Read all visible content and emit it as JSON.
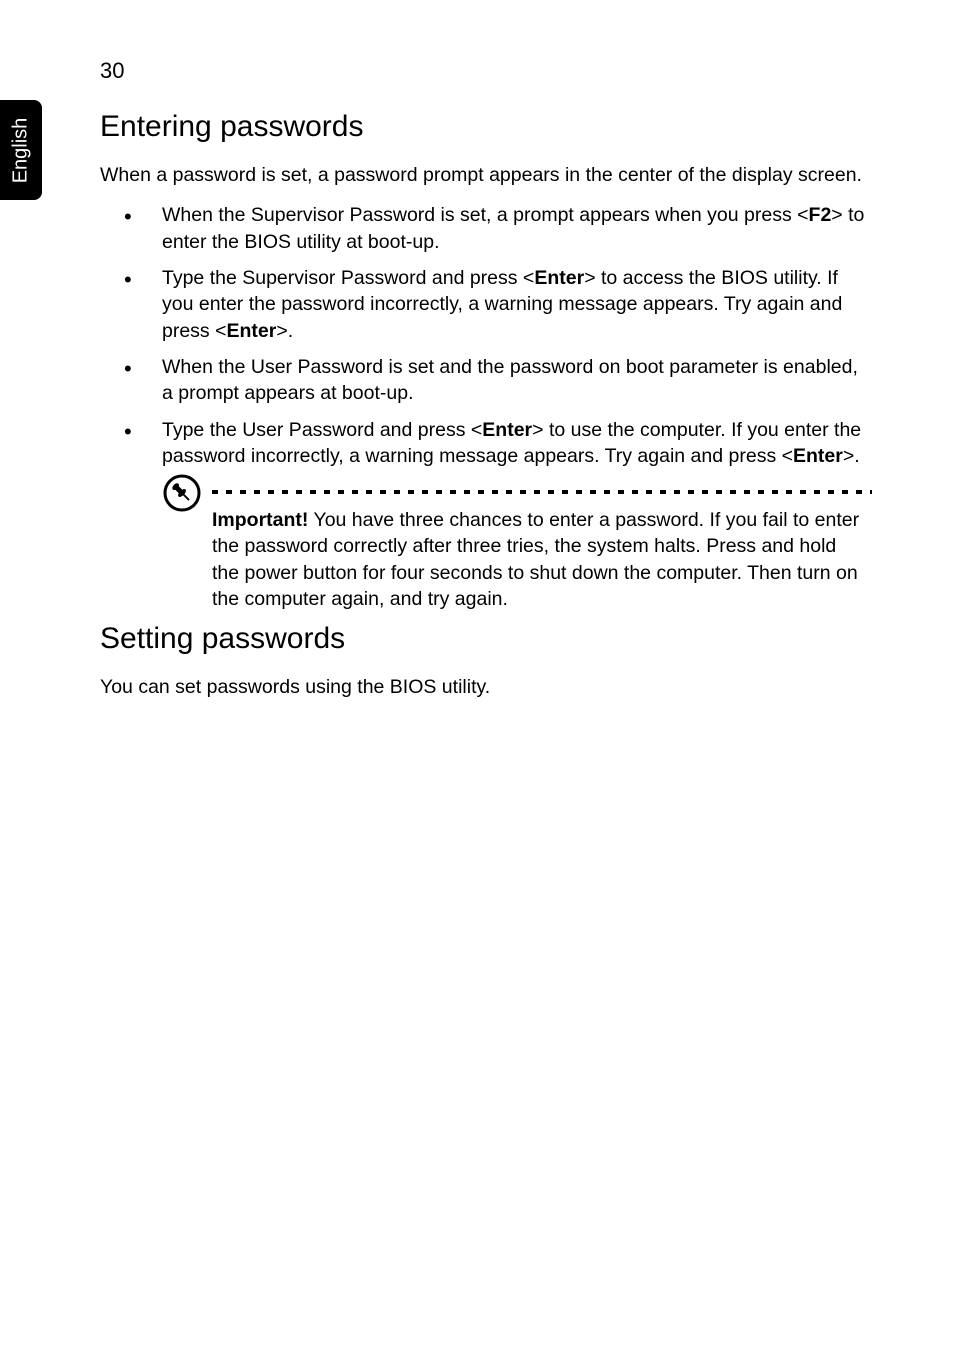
{
  "page": {
    "number": "30",
    "language_tab": "English"
  },
  "section1": {
    "heading": "Entering passwords",
    "intro": "When a password is set, a password prompt appears in the center of the display screen.",
    "bullets": [
      {
        "pre": "When the Supervisor Password is set, a prompt appears when you press <",
        "key1": "F2",
        "post": "> to enter the BIOS utility at boot-up."
      },
      {
        "pre": "Type the Supervisor Password and press <",
        "key1": "Enter",
        "mid": "> to access the BIOS utility. If you enter the password incorrectly, a warning message appears. Try again and press <",
        "key2": "Enter",
        "post": ">."
      },
      {
        "pre": "When the User Password is set and the password on boot parameter is enabled, a prompt appears at boot-up."
      },
      {
        "pre": "Type the User Password and press <",
        "key1": "Enter",
        "mid": "> to use the computer. If you enter the password incorrectly, a warning message appears. Try again and press <",
        "key2": "Enter",
        "post": ">."
      }
    ],
    "note": {
      "label": "Important!",
      "text": " You have three chances to enter a password. If you fail to enter the password correctly after three tries, the system halts. Press and hold the power button for four seconds to shut down the computer. Then turn on the computer again, and try again."
    }
  },
  "section2": {
    "heading": "Setting passwords",
    "intro": "You can set passwords using the BIOS utility."
  }
}
